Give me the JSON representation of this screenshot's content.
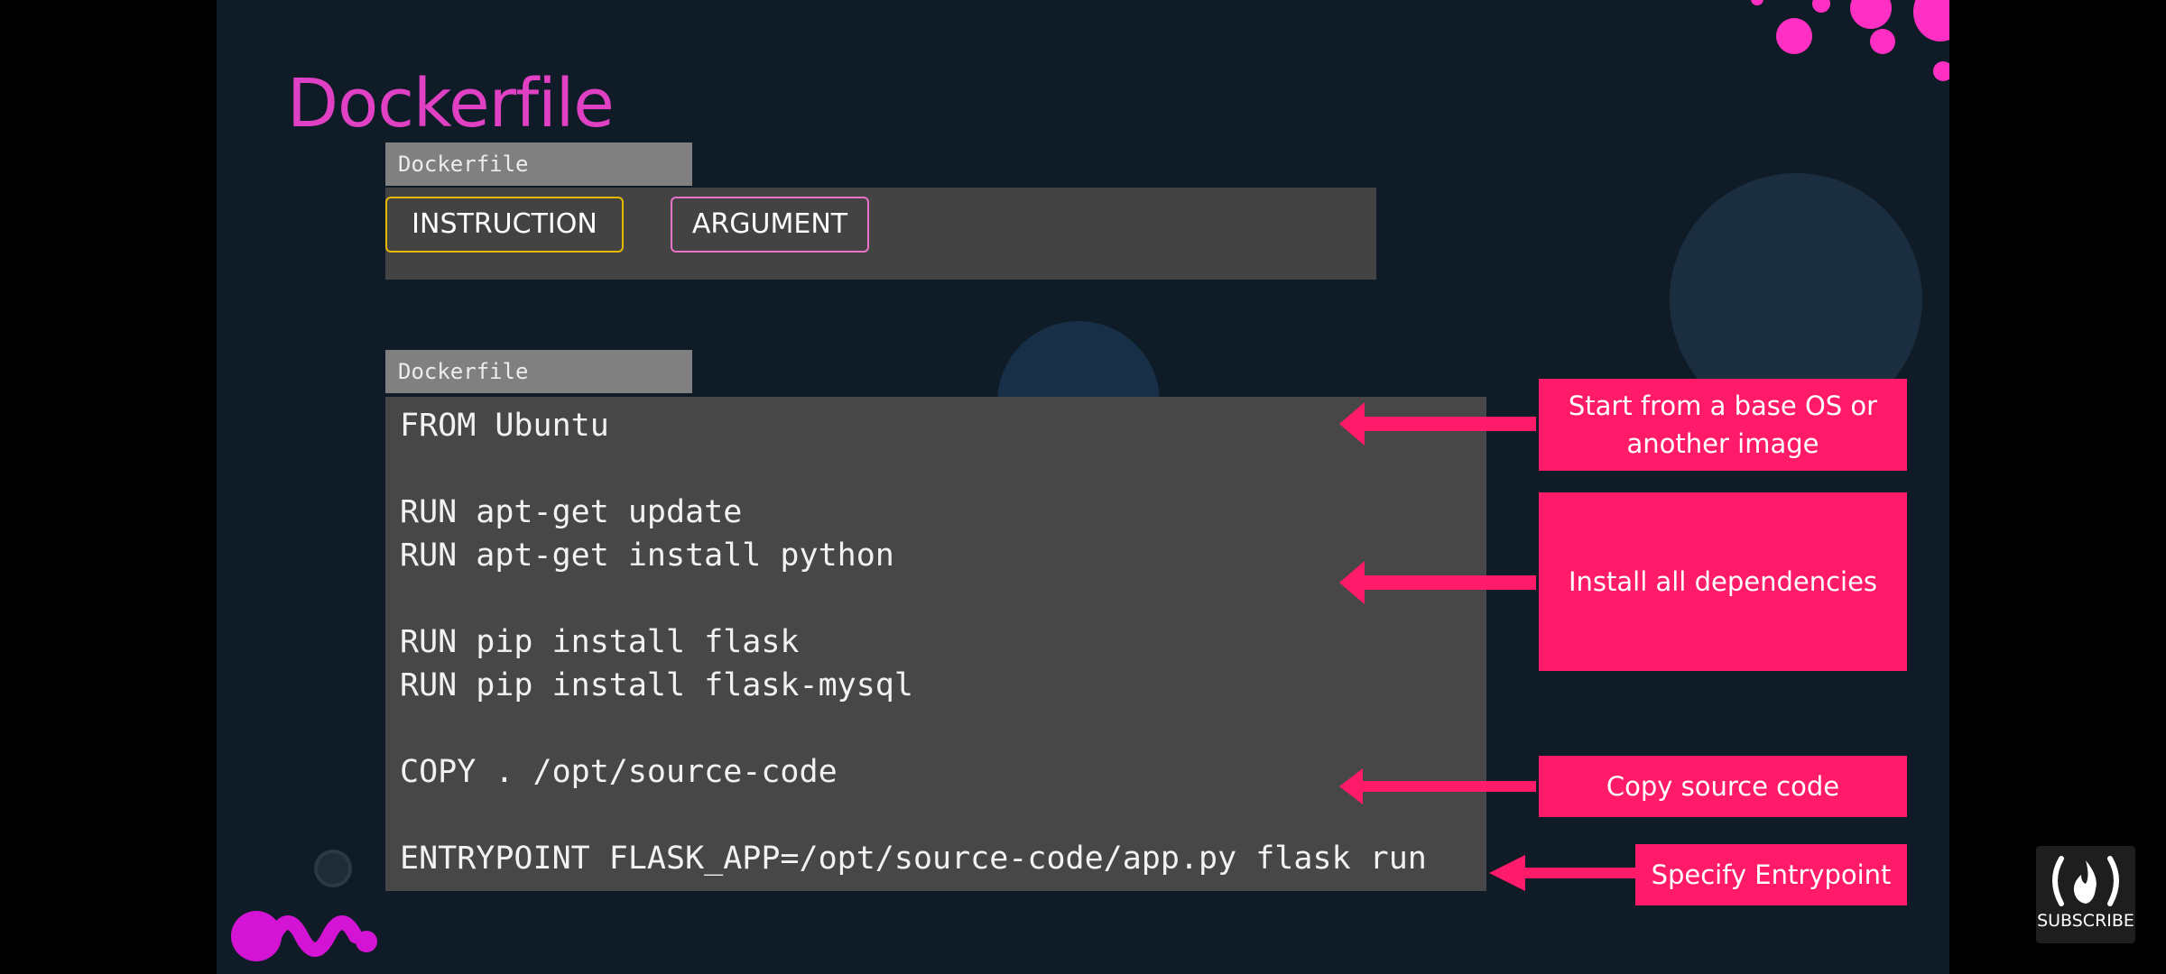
{
  "slide": {
    "title": "Dockerfile",
    "syntax_panel": {
      "file_label": "Dockerfile",
      "instruction_label": "INSTRUCTION",
      "argument_label": "ARGUMENT"
    },
    "code_panel": {
      "file_label": "Dockerfile",
      "lines": [
        "FROM Ubuntu",
        "RUN apt-get update",
        "RUN apt-get install python",
        "RUN pip install flask",
        "RUN pip install flask-mysql",
        "COPY . /opt/source-code",
        "ENTRYPOINT FLASK_APP=/opt/source-code/app.py flask run"
      ]
    },
    "callouts": [
      "Start from a base OS or another image",
      "Install all dependencies",
      "Copy source code",
      "Specify Entrypoint"
    ]
  },
  "overlay": {
    "subscribe_label": "SUBSCRIBE",
    "subscribe_icon": "freecodecamp-flame-icon"
  },
  "colors": {
    "background": "#0f1b26",
    "title": "#e040c4",
    "callout": "#ff1a6a",
    "instruction_border": "#e6b800",
    "argument_border": "#e873c9",
    "code_panel": "#474747",
    "tab": "#808080"
  }
}
